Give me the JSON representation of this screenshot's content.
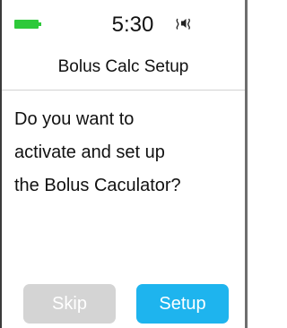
{
  "status_bar": {
    "time": "5:30",
    "battery_icon": "battery-icon",
    "sound_icon": "speaker-vibrate-icon"
  },
  "header": {
    "title": "Bolus Calc Setup"
  },
  "message": {
    "lines": [
      "Do you want to",
      "activate and set up",
      "the Bolus Caculator?"
    ]
  },
  "buttons": {
    "skip_label": "Skip",
    "setup_label": "Setup"
  },
  "colors": {
    "battery": "#2ec93a",
    "skip_button": "#d4d4d4",
    "setup_button": "#1eb4ee",
    "button_text": "#ffffff"
  }
}
